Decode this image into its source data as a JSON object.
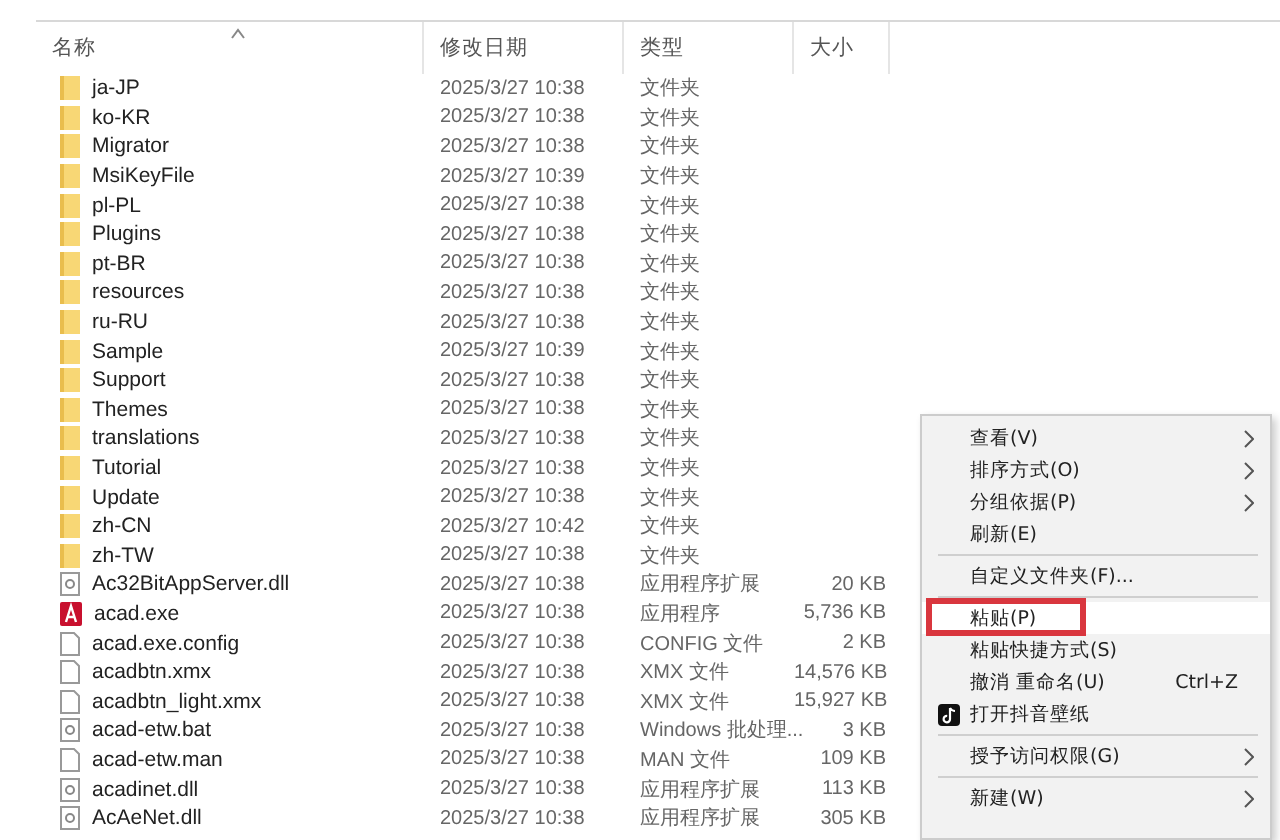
{
  "columns": [
    {
      "label": "名称",
      "sorted": true
    },
    {
      "label": "修改日期",
      "sorted": false
    },
    {
      "label": "类型",
      "sorted": false
    },
    {
      "label": "大小",
      "sorted": false
    }
  ],
  "rows": [
    {
      "kind": "folder",
      "name": "ja-JP",
      "date": "2025/3/27 10:38",
      "type": "文件夹"
    },
    {
      "kind": "folder",
      "name": "ko-KR",
      "date": "2025/3/27 10:38",
      "type": "文件夹"
    },
    {
      "kind": "folder",
      "name": "Migrator",
      "date": "2025/3/27 10:38",
      "type": "文件夹"
    },
    {
      "kind": "folder",
      "name": "MsiKeyFile",
      "date": "2025/3/27 10:39",
      "type": "文件夹"
    },
    {
      "kind": "folder",
      "name": "pl-PL",
      "date": "2025/3/27 10:38",
      "type": "文件夹"
    },
    {
      "kind": "folder",
      "name": "Plugins",
      "date": "2025/3/27 10:38",
      "type": "文件夹"
    },
    {
      "kind": "folder",
      "name": "pt-BR",
      "date": "2025/3/27 10:38",
      "type": "文件夹"
    },
    {
      "kind": "folder",
      "name": "resources",
      "date": "2025/3/27 10:38",
      "type": "文件夹"
    },
    {
      "kind": "folder",
      "name": "ru-RU",
      "date": "2025/3/27 10:38",
      "type": "文件夹"
    },
    {
      "kind": "folder",
      "name": "Sample",
      "date": "2025/3/27 10:39",
      "type": "文件夹"
    },
    {
      "kind": "folder",
      "name": "Support",
      "date": "2025/3/27 10:38",
      "type": "文件夹"
    },
    {
      "kind": "folder",
      "name": "Themes",
      "date": "2025/3/27 10:38",
      "type": "文件夹"
    },
    {
      "kind": "folder",
      "name": "translations",
      "date": "2025/3/27 10:38",
      "type": "文件夹"
    },
    {
      "kind": "folder",
      "name": "Tutorial",
      "date": "2025/3/27 10:38",
      "type": "文件夹"
    },
    {
      "kind": "folder",
      "name": "Update",
      "date": "2025/3/27 10:38",
      "type": "文件夹"
    },
    {
      "kind": "folder",
      "name": "zh-CN",
      "date": "2025/3/27 10:42",
      "type": "文件夹"
    },
    {
      "kind": "folder",
      "name": "zh-TW",
      "date": "2025/3/27 10:38",
      "type": "文件夹"
    },
    {
      "kind": "library",
      "name": "Ac32BitAppServer.dll",
      "date": "2025/3/27 10:38",
      "type": "应用程序扩展",
      "size": "20 KB"
    },
    {
      "kind": "app",
      "name": "acad.exe",
      "date": "2025/3/27 10:38",
      "type": "应用程序",
      "size": "5,736 KB"
    },
    {
      "kind": "file",
      "name": "acad.exe.config",
      "date": "2025/3/27 10:38",
      "type": "CONFIG 文件",
      "size": "2 KB"
    },
    {
      "kind": "file",
      "name": "acadbtn.xmx",
      "date": "2025/3/27 10:38",
      "type": "XMX 文件",
      "size": "14,576 KB"
    },
    {
      "kind": "file",
      "name": "acadbtn_light.xmx",
      "date": "2025/3/27 10:38",
      "type": "XMX 文件",
      "size": "15,927 KB"
    },
    {
      "kind": "library",
      "name": "acad-etw.bat",
      "date": "2025/3/27 10:38",
      "type": "Windows 批处理...",
      "size": "3 KB"
    },
    {
      "kind": "file",
      "name": "acad-etw.man",
      "date": "2025/3/27 10:38",
      "type": "MAN 文件",
      "size": "109 KB"
    },
    {
      "kind": "library",
      "name": "acadinet.dll",
      "date": "2025/3/27 10:38",
      "type": "应用程序扩展",
      "size": "113 KB"
    },
    {
      "kind": "library",
      "name": "AcAeNet.dll",
      "date": "2025/3/27 10:38",
      "type": "应用程序扩展",
      "size": "305 KB"
    }
  ],
  "context_menu": [
    {
      "kind": "item",
      "label": "查看(V)",
      "submenu": true,
      "highlighted": false
    },
    {
      "kind": "item",
      "label": "排序方式(O)",
      "submenu": true,
      "highlighted": false
    },
    {
      "kind": "item",
      "label": "分组依据(P)",
      "submenu": true,
      "highlighted": false
    },
    {
      "kind": "item",
      "label": "刷新(E)",
      "submenu": false,
      "highlighted": false
    },
    {
      "kind": "separator"
    },
    {
      "kind": "item",
      "label": "自定义文件夹(F)...",
      "submenu": false,
      "highlighted": false
    },
    {
      "kind": "separator"
    },
    {
      "kind": "item",
      "label": "粘贴(P)",
      "submenu": false,
      "highlighted": true
    },
    {
      "kind": "item",
      "label": "粘贴快捷方式(S)",
      "submenu": false,
      "highlighted": false
    },
    {
      "kind": "item",
      "label": "撤消 重命名(U)",
      "shortcut": "Ctrl+Z",
      "submenu": false,
      "highlighted": false
    },
    {
      "kind": "app",
      "label": "打开抖音壁纸",
      "submenu": false,
      "highlighted": false
    },
    {
      "kind": "separator"
    },
    {
      "kind": "item",
      "label": "授予访问权限(G)",
      "submenu": true,
      "highlighted": false
    },
    {
      "kind": "separator"
    },
    {
      "kind": "item",
      "label": "新建(W)",
      "submenu": true,
      "highlighted": false
    }
  ]
}
